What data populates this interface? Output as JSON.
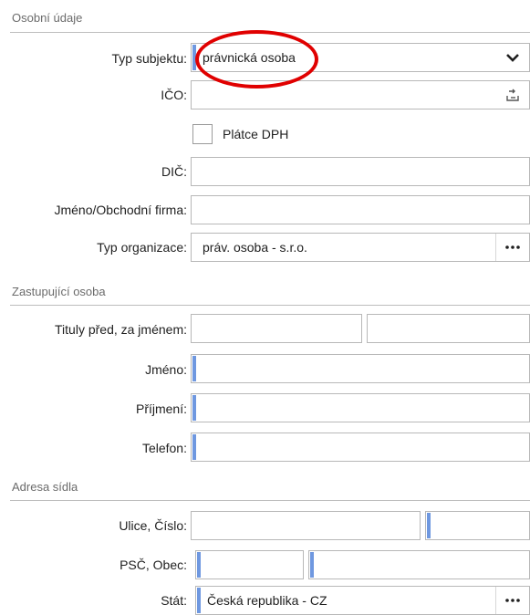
{
  "sections": {
    "personal": "Osobní údaje",
    "representative": "Zastupující osoba",
    "address": "Adresa sídla"
  },
  "personal": {
    "typ_subjektu_label": "Typ subjektu:",
    "typ_subjektu_value": "právnická osoba",
    "ico_label": "IČO:",
    "ico_value": "",
    "platce_dph_label": "Plátce DPH",
    "dic_label": "DIČ:",
    "dic_value": "",
    "jmeno_firma_label": "Jméno/Obchodní firma:",
    "jmeno_firma_value": "",
    "typ_organizace_label": "Typ organizace:",
    "typ_organizace_value": "práv. osoba - s.r.o."
  },
  "representative": {
    "tituly_label": "Tituly před, za jménem:",
    "jmeno_label": "Jméno:",
    "prijmeni_label": "Příjmení:",
    "telefon_label": "Telefon:"
  },
  "address": {
    "ulice_label": "Ulice, Číslo:",
    "psc_label": "PSČ, Obec:",
    "stat_label": "Stát:",
    "stat_value": "Česká republika - CZ"
  },
  "icons": {
    "dropdown": "chevron-down-icon",
    "import": "import-icon",
    "more": "ellipsis-icon"
  },
  "colors": {
    "required_marker": "#6f98e0",
    "annotation": "#e00000"
  }
}
